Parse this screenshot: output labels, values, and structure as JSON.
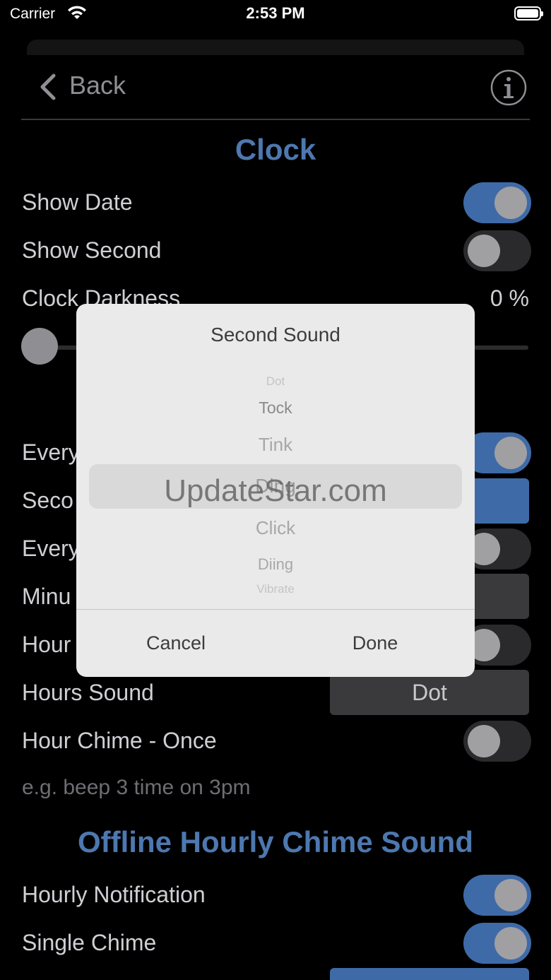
{
  "status_bar": {
    "carrier": "Carrier",
    "time": "2:53 PM"
  },
  "nav": {
    "back_label": "Back"
  },
  "clock": {
    "title": "Clock",
    "show_date_label": "Show Date",
    "show_date_on": true,
    "show_second_label": "Show Second",
    "show_second_on": false,
    "darkness_label": "Clock Darkness",
    "darkness_value": "0 %",
    "darkness_level": 0
  },
  "sound_rows": {
    "every_second_label": "Every",
    "every_second_on": true,
    "second_sound_label": "Seco",
    "every_minute_label": "Every",
    "every_minute_on": false,
    "minute_sound_label": "Minu",
    "hour_label": "Hour",
    "hour_on": false,
    "hours_sound_label": "Hours Sound",
    "hours_sound_value": "Dot",
    "hour_chime_once_label": "Hour Chime - Once",
    "hour_chime_once_on": false,
    "hint": "e.g. beep 3 time on 3pm"
  },
  "offline": {
    "title": "Offline Hourly Chime Sound",
    "hourly_notification_label": "Hourly Notification",
    "hourly_notification_on": true,
    "single_chime_label": "Single Chime",
    "single_chime_on": true
  },
  "modal": {
    "title": "Second Sound",
    "options": [
      "Dot",
      "Tock",
      "Tink",
      "Ding",
      "Click",
      "Diing",
      "Vibrate"
    ],
    "selected": "Ding",
    "cancel_label": "Cancel",
    "done_label": "Done",
    "watermark": "UpdateStar.com"
  },
  "colors": {
    "accent": "#4d78b0",
    "toggle_on": "#3f6aa8",
    "background": "#000000"
  }
}
